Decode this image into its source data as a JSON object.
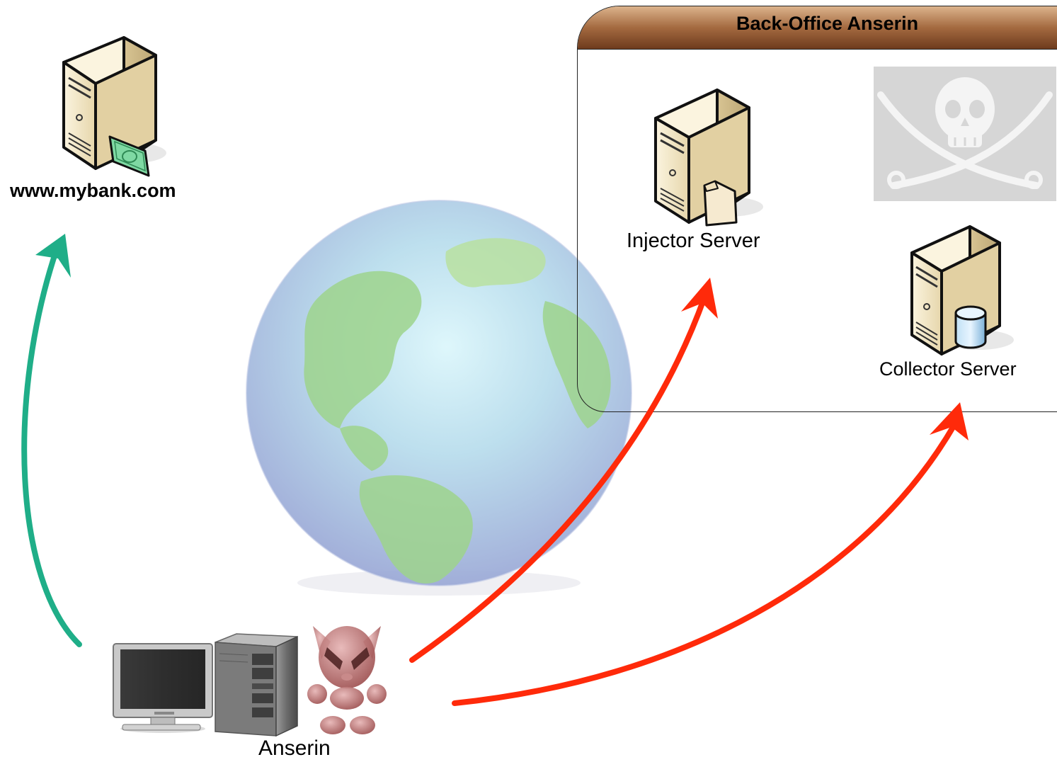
{
  "nodes": {
    "bank": {
      "label": "www.mybank.com"
    },
    "backoffice": {
      "title": "Back-Office Anserin"
    },
    "injector": {
      "label": "Injector Server"
    },
    "collector": {
      "label": "Collector Server"
    },
    "client": {
      "label": "Anserin"
    }
  },
  "colors": {
    "green_arrow": "#1fae88",
    "red_arrow": "#ff2a0a",
    "header_top": "#c99a6e",
    "header_bottom": "#7a4524",
    "server_body": "#f1e6c8",
    "banknote": "#6fd29a"
  },
  "icons": [
    "bank-server-icon",
    "banknote-icon",
    "globe-icon",
    "injector-server-icon",
    "folder-icon",
    "collector-server-icon",
    "database-icon",
    "jolly-roger-icon",
    "monitor-icon",
    "tower-pc-icon",
    "malware-mascot-icon"
  ],
  "edges": [
    {
      "from": "client",
      "to": "bank",
      "color": "green_arrow"
    },
    {
      "from": "client",
      "to": "injector",
      "color": "red_arrow"
    },
    {
      "from": "client",
      "to": "collector",
      "color": "red_arrow"
    }
  ]
}
